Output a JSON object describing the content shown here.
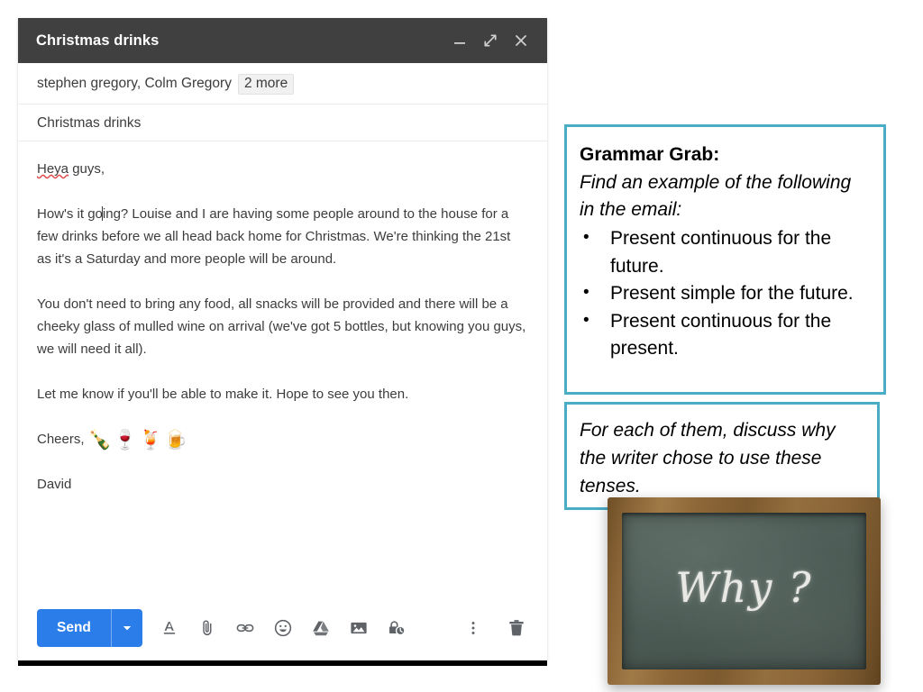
{
  "compose": {
    "title": "Christmas drinks",
    "window_controls": [
      {
        "name": "minimize",
        "glyph": "minimize-icon"
      },
      {
        "name": "expand",
        "glyph": "expand-icon"
      },
      {
        "name": "close",
        "glyph": "close-icon"
      }
    ],
    "recipients": "stephen gregory, Colm Gregory",
    "more_recipients": "2 more",
    "subject": "Christmas drinks",
    "body": {
      "greeting_misspelled": "Heya",
      "greeting_rest": " guys,",
      "paragraph_1_a": "How's it go",
      "paragraph_1_b": "ing? Louise and I are having some people around to the house for a few drinks before we all head back home for Christmas. We're thinking the 21st as it's a Saturday and more people will be around.",
      "paragraph_2": "You don't need to bring any food, all snacks will be provided and there will be a cheeky glass of mulled wine on arrival (we've got 5 bottles, but knowing you guys, we will need it all).",
      "paragraph_3": "Let me know if you'll be able to make it. Hope to see you then.",
      "signoff": "Cheers, ",
      "emojis": "🍾🍷🍹🍺",
      "signature": "David"
    },
    "toolbar": {
      "send_label": "Send",
      "send_options": "send-options-caret-icon",
      "icons": [
        {
          "name": "formatting-options-icon"
        },
        {
          "name": "attach-file-icon"
        },
        {
          "name": "insert-link-icon"
        },
        {
          "name": "insert-emoji-icon"
        },
        {
          "name": "insert-drive-icon"
        },
        {
          "name": "insert-photo-icon"
        },
        {
          "name": "confidential-mode-icon"
        },
        {
          "name": "more-options-icon"
        },
        {
          "name": "discard-draft-icon"
        }
      ]
    }
  },
  "grammar_grab": {
    "title": "Grammar Grab:",
    "instruction": "Find an example of the following in the email:",
    "items": [
      "Present continuous for the future.",
      "Present simple for the future.",
      "Present continuous for the present."
    ]
  },
  "discuss": {
    "text": "For each of them, discuss why the writer chose to use these tenses."
  },
  "chalkboard": {
    "text": "Why ?"
  },
  "colors": {
    "header_bar": "#404040",
    "send_button": "#2b7de9",
    "box_border": "#4bacc6",
    "chalkboard_frame": "#8a6437",
    "chalkboard_surface": "#4e5d57",
    "spellcheck_underline": "#e04a4a"
  }
}
